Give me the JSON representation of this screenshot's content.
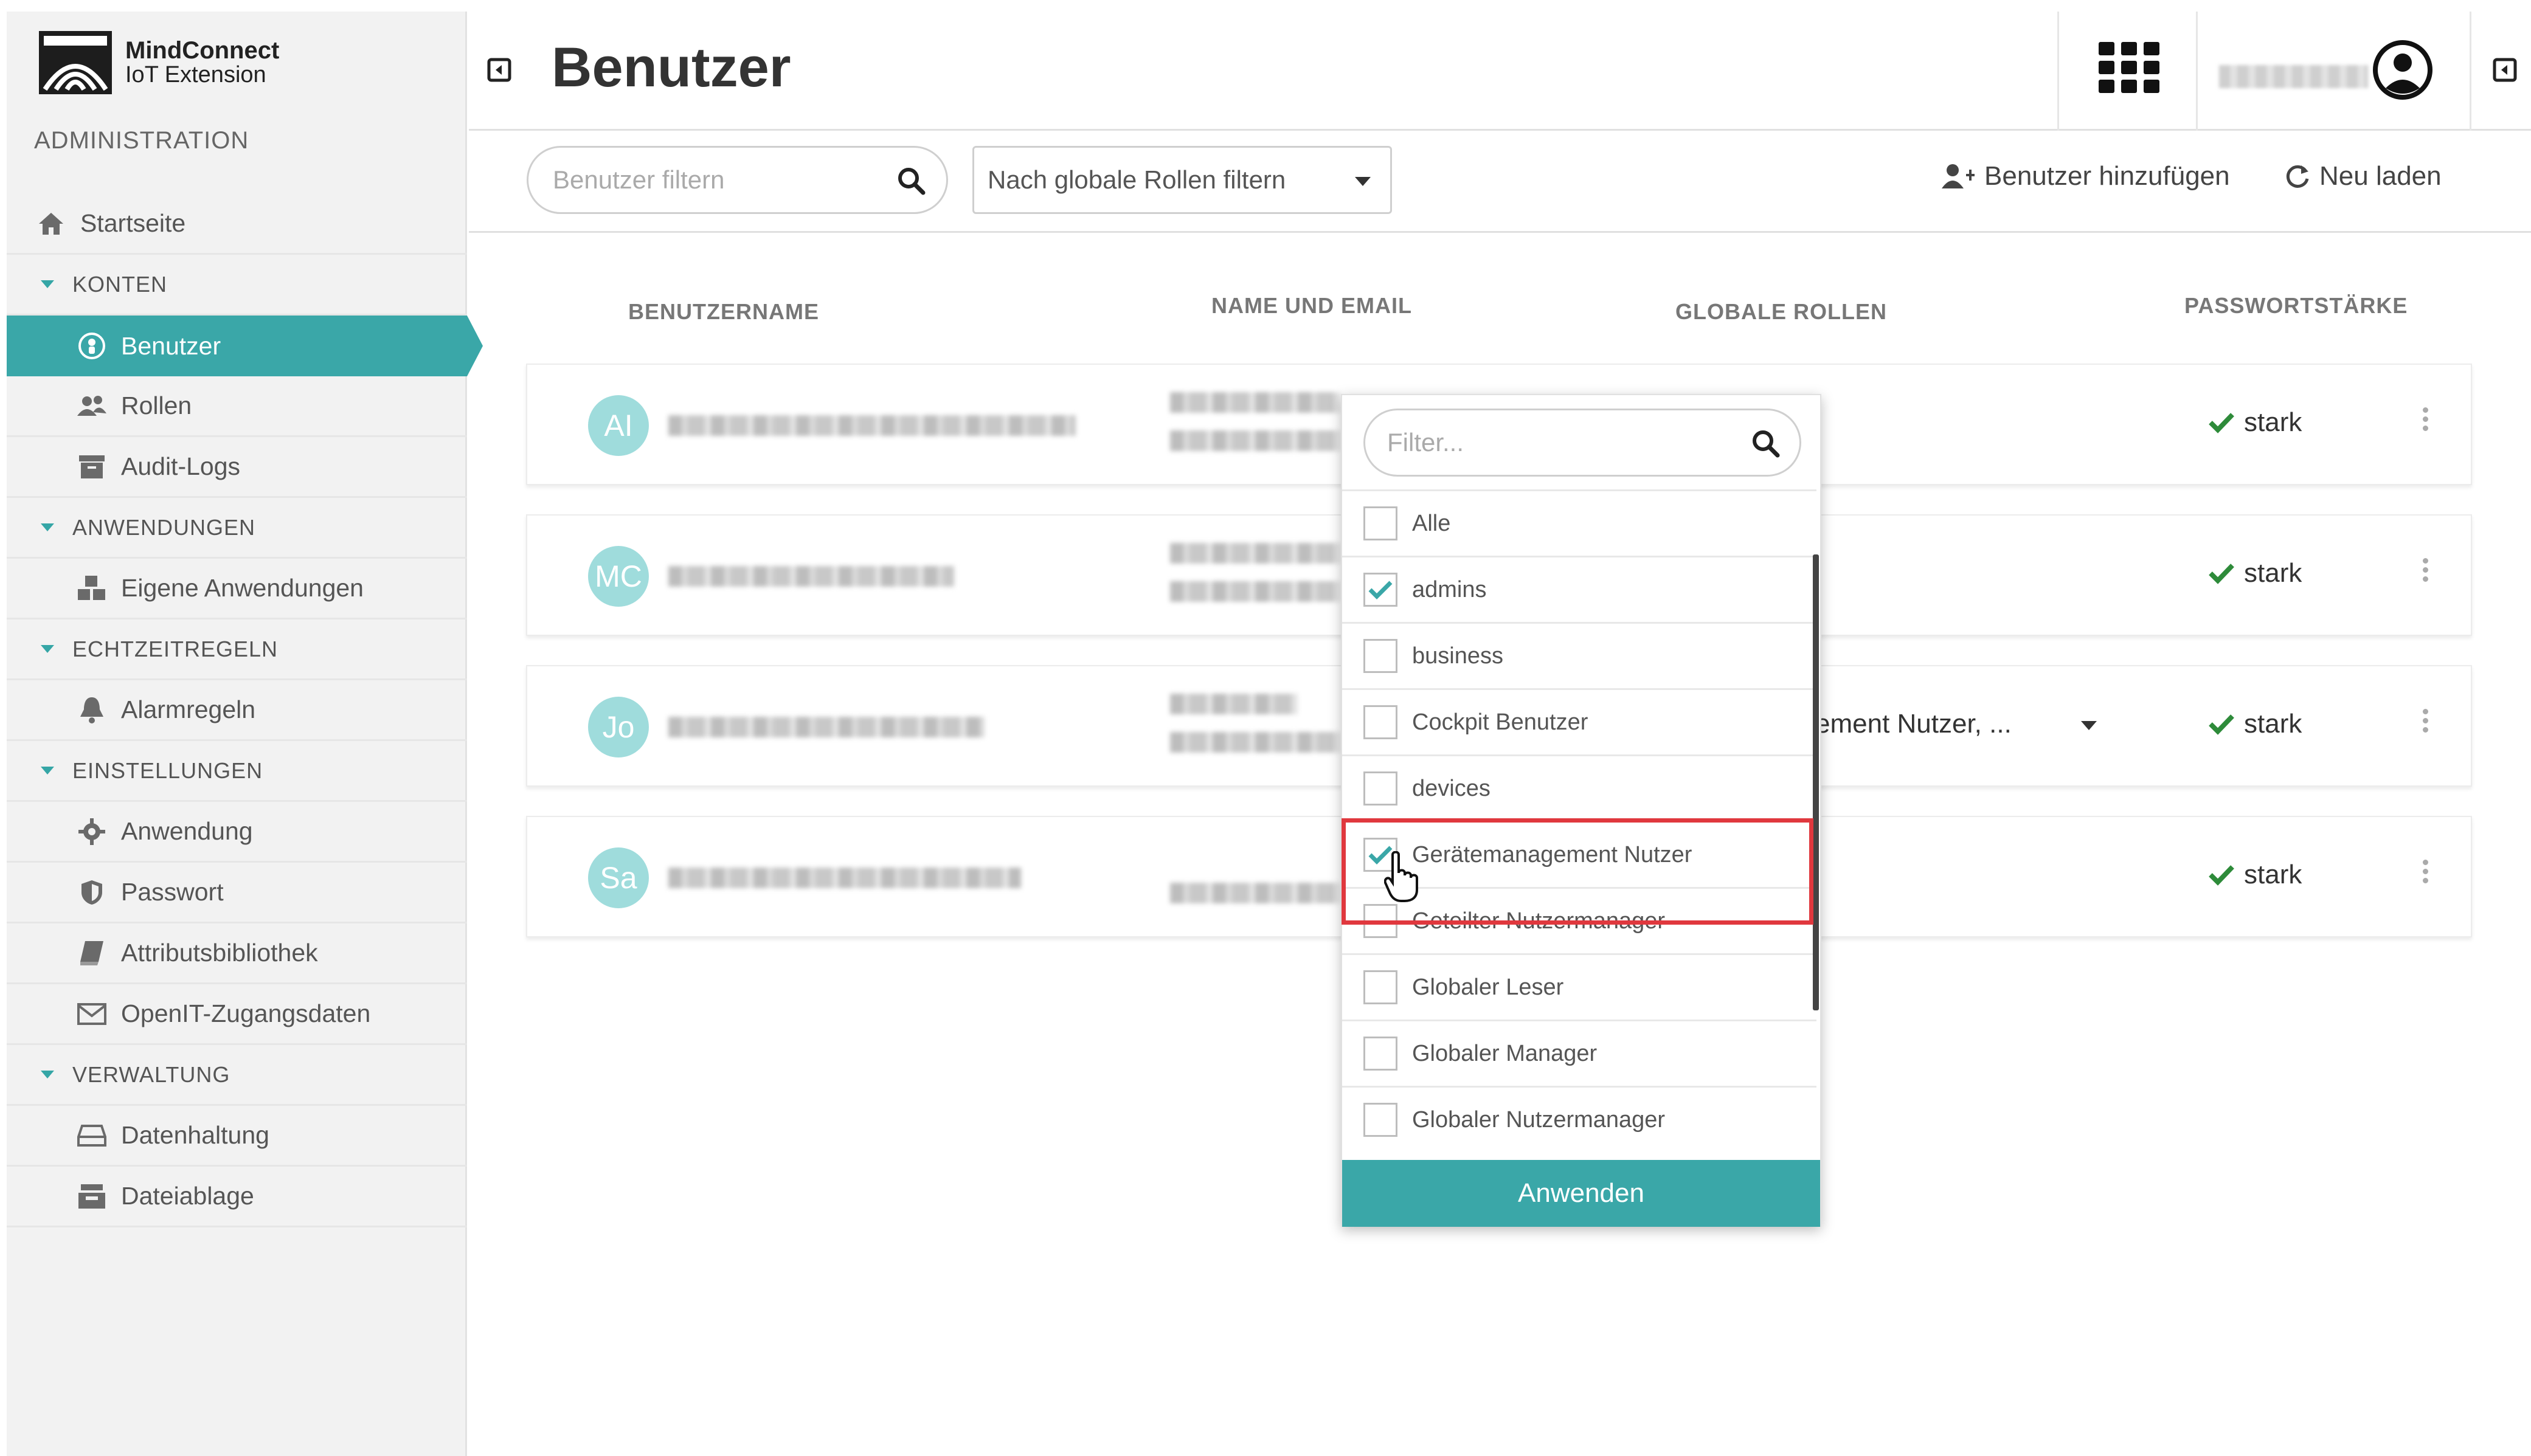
{
  "sidebar": {
    "logo_line1": "MindConnect",
    "logo_line2": "IoT Extension",
    "admin_label": "ADMINISTRATION",
    "home": "Startseite",
    "sections": {
      "konten": "KONTEN",
      "anwendungen": "ANWENDUNGEN",
      "echtzeit": "ECHTZEITREGELN",
      "einstellungen": "EINSTELLUNGEN",
      "verwaltung": "VERWALTUNG"
    },
    "items": {
      "benutzer": "Benutzer",
      "rollen": "Rollen",
      "audit": "Audit-Logs",
      "eigene": "Eigene Anwendungen",
      "alarm": "Alarmregeln",
      "anwendung": "Anwendung",
      "passwort": "Passwort",
      "attribut": "Attributsbibliothek",
      "openit": "OpenIT-Zugangsdaten",
      "datenhaltung": "Datenhaltung",
      "dateiablage": "Dateiablage"
    }
  },
  "header": {
    "title": "Benutzer"
  },
  "toolbar": {
    "search_placeholder": "Benutzer filtern",
    "role_filter": "Nach globale Rollen filtern",
    "add_user": "Benutzer hinzufügen",
    "reload": "Neu laden"
  },
  "table": {
    "col_username": "BENUTZERNAME",
    "col_name_email": "NAME UND EMAIL",
    "col_roles": "GLOBALE ROLLEN",
    "col_password": "PASSWORTSTÄRKE",
    "rows": [
      {
        "initials": "AI",
        "strength": "stark"
      },
      {
        "initials": "MC",
        "strength": "stark"
      },
      {
        "initials": "Jo",
        "strength": "stark",
        "roles": "ement Nutzer, ..."
      },
      {
        "initials": "Sa",
        "strength": "stark"
      }
    ]
  },
  "dropdown": {
    "filter_placeholder": "Filter...",
    "options": [
      {
        "label": "Alle",
        "checked": false
      },
      {
        "label": "admins",
        "checked": true
      },
      {
        "label": "business",
        "checked": false
      },
      {
        "label": "Cockpit Benutzer",
        "checked": false
      },
      {
        "label": "devices",
        "checked": false
      },
      {
        "label": "Gerätemanagement Nutzer",
        "checked": true
      },
      {
        "label": "Geteilter Nutzermanager",
        "checked": false
      },
      {
        "label": "Globaler Leser",
        "checked": false
      },
      {
        "label": "Globaler Manager",
        "checked": false
      },
      {
        "label": "Globaler Nutzermanager",
        "checked": false
      }
    ],
    "apply": "Anwenden"
  },
  "colors": {
    "accent": "#3aa7a8",
    "check_green": "#2e8b3a",
    "highlight_red": "#e0383e"
  }
}
